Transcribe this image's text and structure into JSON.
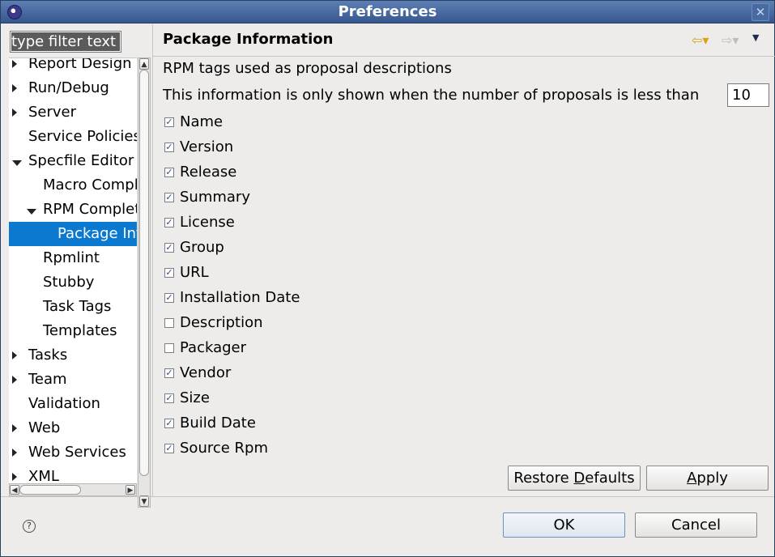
{
  "window": {
    "title": "Preferences"
  },
  "filter": {
    "placeholder": "type filter text"
  },
  "tree": {
    "items": [
      {
        "label": "Report Design",
        "level": 0,
        "expander": "collapsed"
      },
      {
        "label": "Run/Debug",
        "level": 0,
        "expander": "collapsed"
      },
      {
        "label": "Server",
        "level": 0,
        "expander": "collapsed"
      },
      {
        "label": "Service Policies",
        "level": 0,
        "expander": "none"
      },
      {
        "label": "Specfile Editor",
        "level": 0,
        "expander": "expanded"
      },
      {
        "label": "Macro Completion",
        "level": 1,
        "expander": "none"
      },
      {
        "label": "RPM Completion",
        "level": 1,
        "expander": "expanded"
      },
      {
        "label": "Package Information",
        "level": 2,
        "expander": "none",
        "selected": true
      },
      {
        "label": "Rpmlint",
        "level": 1,
        "expander": "none"
      },
      {
        "label": "Stubby",
        "level": 1,
        "expander": "none"
      },
      {
        "label": "Task Tags",
        "level": 1,
        "expander": "none"
      },
      {
        "label": "Templates",
        "level": 1,
        "expander": "none"
      },
      {
        "label": "Tasks",
        "level": 0,
        "expander": "collapsed"
      },
      {
        "label": "Team",
        "level": 0,
        "expander": "collapsed"
      },
      {
        "label": "Validation",
        "level": 0,
        "expander": "none"
      },
      {
        "label": "Web",
        "level": 0,
        "expander": "collapsed"
      },
      {
        "label": "Web Services",
        "level": 0,
        "expander": "collapsed"
      },
      {
        "label": "XML",
        "level": 0,
        "expander": "collapsed"
      }
    ]
  },
  "page": {
    "title": "Package Information",
    "intro": "RPM tags used as proposal descriptions",
    "info": "This information is only shown when the number of proposals is less than",
    "threshold": "10",
    "checkboxes": [
      {
        "label": "Name",
        "checked": true
      },
      {
        "label": "Version",
        "checked": true
      },
      {
        "label": "Release",
        "checked": true
      },
      {
        "label": "Summary",
        "checked": true
      },
      {
        "label": "License",
        "checked": true
      },
      {
        "label": "Group",
        "checked": true
      },
      {
        "label": "URL",
        "checked": true
      },
      {
        "label": "Installation Date",
        "checked": true
      },
      {
        "label": "Description",
        "checked": false
      },
      {
        "label": "Packager",
        "checked": false
      },
      {
        "label": "Vendor",
        "checked": true
      },
      {
        "label": "Size",
        "checked": true
      },
      {
        "label": "Build Date",
        "checked": true
      },
      {
        "label": "Source Rpm",
        "checked": true
      }
    ],
    "restore_defaults": {
      "pre": "Restore ",
      "mnemonic": "D",
      "post": "efaults"
    },
    "apply": {
      "pre": "",
      "mnemonic": "A",
      "post": "pply"
    }
  },
  "footer": {
    "ok_label": "OK",
    "cancel_label": "Cancel"
  },
  "colors": {
    "selection": "#0b79d0",
    "titlebar": "#4a6ba0"
  }
}
